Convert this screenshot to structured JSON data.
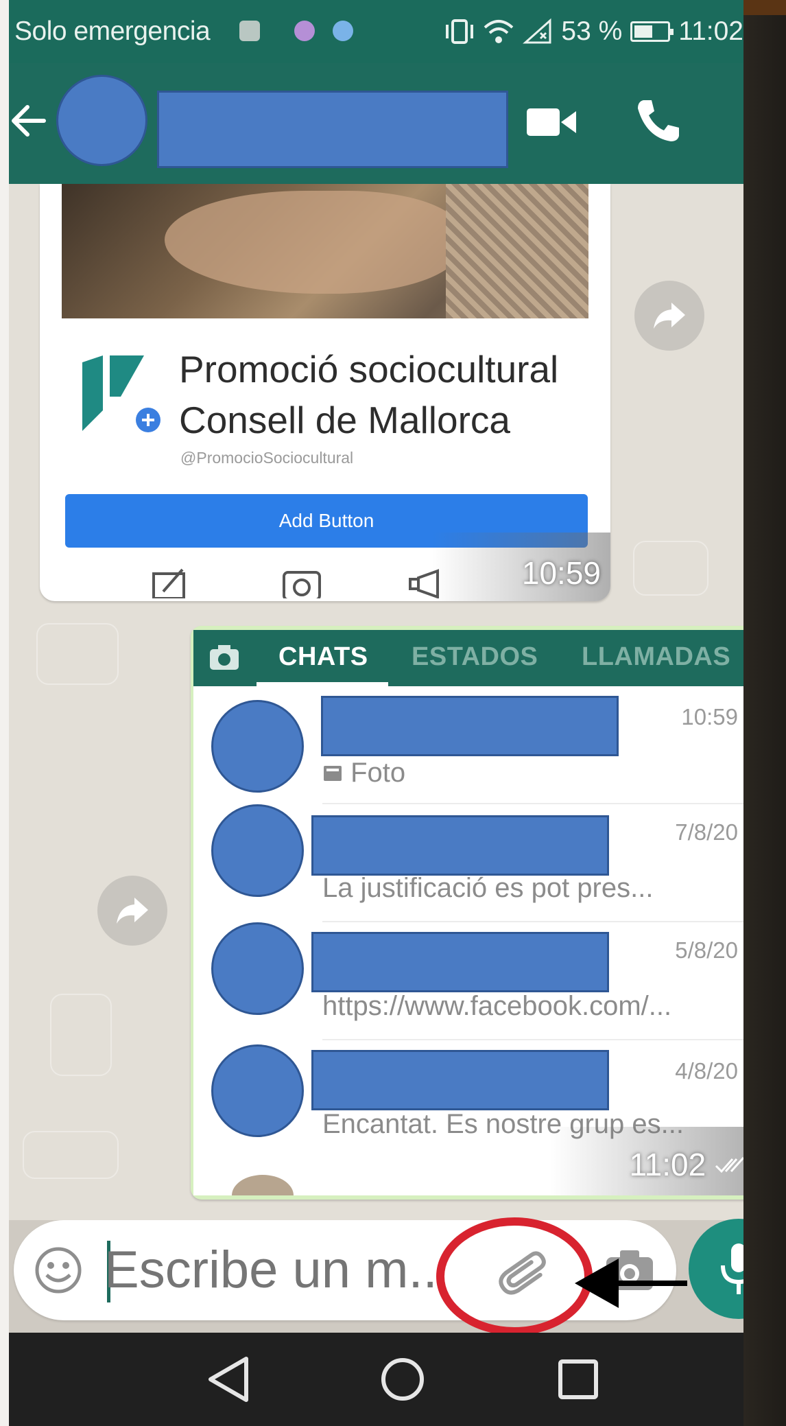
{
  "status_bar": {
    "carrier_text": "Solo emergencia",
    "battery_text": "53 %",
    "time": "11:02"
  },
  "app_bar": {
    "contact_name_redacted": true
  },
  "shared_page": {
    "name_line_1": "Promoció sociocultural",
    "name_line_2": "Consell de Mallorca",
    "handle": "@PromocioSociocultural",
    "button_label": "Add Button",
    "timestamp": "10:59"
  },
  "screenshot_message": {
    "tabs": [
      {
        "label": "CHATS",
        "active": true
      },
      {
        "label": "ESTADOS",
        "active": false
      },
      {
        "label": "LLAMADAS",
        "active": false
      }
    ],
    "chats": [
      {
        "date": "10:59",
        "preview": "Foto"
      },
      {
        "date": "7/8/20",
        "preview": "La justificació es pot pres..."
      },
      {
        "date": "5/8/20",
        "preview": "https://www.facebook.com/..."
      },
      {
        "date": "4/8/20",
        "preview": "Encantat. Es nostre grup es..."
      }
    ],
    "timestamp": "11:02"
  },
  "composer": {
    "placeholder": "Escribe un m..."
  },
  "colors": {
    "header": "#1e6b5d",
    "accent_fab": "#1e8e7e",
    "redaction": "#4a7bc4",
    "annotation": "#d8232f"
  },
  "icons": [
    "back-arrow-icon",
    "video-call-icon",
    "phone-icon",
    "more-vert-icon",
    "share-icon",
    "camera-icon",
    "emoji-icon",
    "attach-icon",
    "mic-icon",
    "nav-back-icon",
    "nav-home-icon",
    "nav-recents-icon"
  ]
}
